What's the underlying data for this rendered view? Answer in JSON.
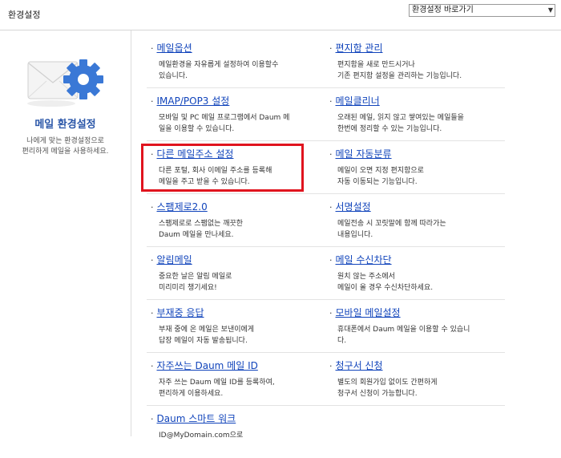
{
  "header": {
    "title": "환경설정",
    "quick_select_value": "환경설정 바로가기"
  },
  "sidebar": {
    "title": "메일 환경설정",
    "description_line1": "나에게 맞는 환경설정으로",
    "description_line2": "편리하게 메일을 사용하세요."
  },
  "colors": {
    "link": "#1144bb",
    "highlight": "#e0141e",
    "sidebar_title": "#2a56a8"
  },
  "items": [
    {
      "title": "메일옵션",
      "desc1": "메일환경을 자유롭게 설정하여 이용할수",
      "desc2": "있습니다."
    },
    {
      "title": "편지함 관리",
      "desc1": "편지함을 새로 만드시거나",
      "desc2": "기존 편지함 설정을 관리하는 기능입니다."
    },
    {
      "title": "IMAP/POP3 설정",
      "desc1": "모바일 및 PC 메일 프로그램에서 Daum 메",
      "desc2": "일을 이용할 수 있습니다."
    },
    {
      "title": "메일클리너",
      "desc1": "오래된 메일, 읽지 않고 쌓여있는 메일들을",
      "desc2": "한번에 정리할 수 있는 기능입니다."
    },
    {
      "title": "다른 메일주소 설정",
      "desc1": "다른 포털, 회사 이메일 주소를 등록해",
      "desc2": "메일을 주고 받을 수 있습니다."
    },
    {
      "title": "메일 자동분류",
      "desc1": "메일이 오면 지정 편지함으로",
      "desc2": "자동 이동되는 기능입니다."
    },
    {
      "title": "스팸제로2.0",
      "desc1": "스팸제로로 스팸없는 깨끗한",
      "desc2": "Daum 메일을 만나세요."
    },
    {
      "title": "서명설정",
      "desc1": "메일전송 시 꼬릿말에 함께 따라가는",
      "desc2": "내용입니다."
    },
    {
      "title": "알림메일",
      "desc1": "중요한 날은 알림 메일로",
      "desc2": "미리미리 챙기세요!"
    },
    {
      "title": "메일 수신차단",
      "desc1": "원치 않는 주소에서",
      "desc2": "메일이 올 경우 수신차단하세요."
    },
    {
      "title": "부재중 응답",
      "desc1": "부재 중에 온 메일은 보낸이에게",
      "desc2": "답장 메일이 자동 발송됩니다."
    },
    {
      "title": "모바일 메일설정",
      "desc1": "휴대폰에서 Daum 메일을 이용할 수 있습니",
      "desc2": "다."
    },
    {
      "title": "자주쓰는 Daum 메일 ID",
      "desc1": "자주 쓰는 Daum 메일 ID를 등록하여,",
      "desc2": "편리하게 이용하세요."
    },
    {
      "title": "청구서 신청",
      "desc1": "별도의 회원가입 없이도 간편하게",
      "desc2": "청구서 신청이 가능합니다."
    },
    {
      "title": "Daum 스마트 워크",
      "desc1": "ID@MyDomain.com으로",
      "desc2": ""
    }
  ]
}
